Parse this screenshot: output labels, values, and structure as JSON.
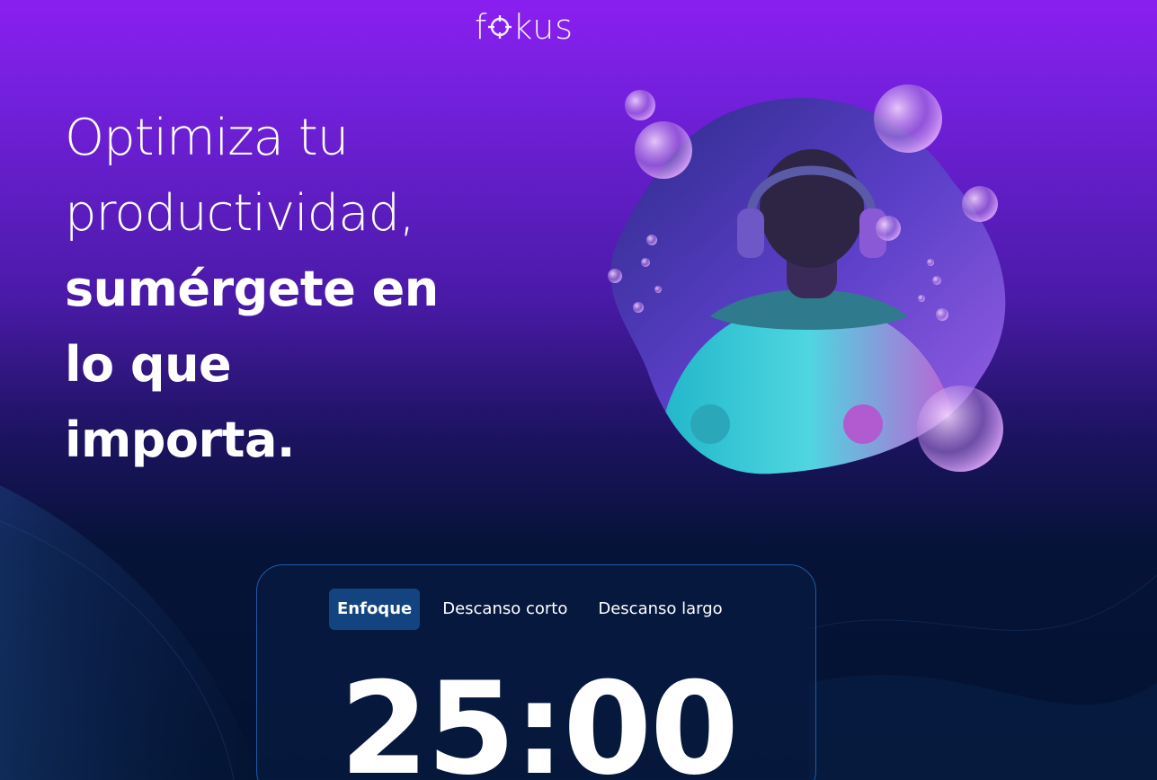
{
  "brand": {
    "logo_prefix": "f",
    "logo_suffix": "kus",
    "logo_icon": "target-icon"
  },
  "hero": {
    "headline_light": "Optimiza tu\nproductividad,",
    "headline_bold": "sumérgete en\nlo que\nimporta.",
    "image": "man-with-headphones-underwater-bubbles"
  },
  "timer": {
    "tabs": [
      {
        "label": "Enfoque",
        "active": true
      },
      {
        "label": "Descanso corto",
        "active": false
      },
      {
        "label": "Descanso largo",
        "active": false
      }
    ],
    "time": "25:00"
  },
  "colors": {
    "gradient_top": "#8a1ff0",
    "gradient_bottom": "#021230",
    "card_border": "#1e5aa8",
    "active_tab": "#144480"
  }
}
